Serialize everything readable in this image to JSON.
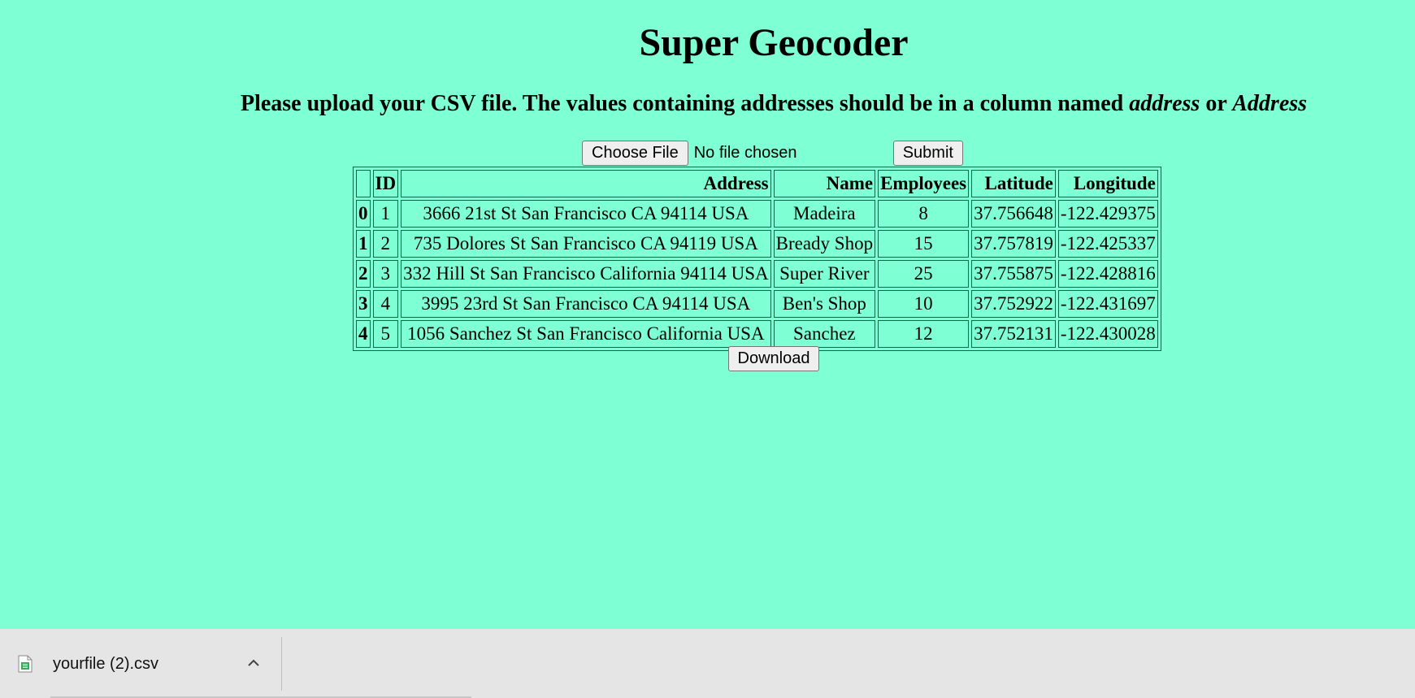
{
  "page": {
    "title": "Super Geocoder",
    "instructions_prefix": "Please upload your CSV file. The values containing addresses should be in a column named ",
    "instructions_em1": "address",
    "instructions_mid": " or ",
    "instructions_em2": "Address",
    "background_color": "#7fffd4"
  },
  "upload": {
    "choose_file_label": "Choose File",
    "file_status": "No file chosen",
    "submit_label": "Submit"
  },
  "table": {
    "headers": [
      "",
      "ID",
      "Address",
      "Name",
      "Employees",
      "Latitude",
      "Longitude"
    ],
    "rows": [
      {
        "index": "0",
        "id": "1",
        "address": "3666 21st St San Francisco CA 94114 USA",
        "name": "Madeira",
        "employees": "8",
        "latitude": "37.756648",
        "longitude": "-122.429375"
      },
      {
        "index": "1",
        "id": "2",
        "address": "735 Dolores St San Francisco CA 94119 USA",
        "name": "Bready Shop",
        "employees": "15",
        "latitude": "37.757819",
        "longitude": "-122.425337"
      },
      {
        "index": "2",
        "id": "3",
        "address": "332 Hill St San Francisco California 94114 USA",
        "name": "Super River",
        "employees": "25",
        "latitude": "37.755875",
        "longitude": "-122.428816"
      },
      {
        "index": "3",
        "id": "4",
        "address": "3995 23rd St San Francisco CA 94114 USA",
        "name": "Ben's Shop",
        "employees": "10",
        "latitude": "37.752922",
        "longitude": "-122.431697"
      },
      {
        "index": "4",
        "id": "5",
        "address": "1056 Sanchez St San Francisco California USA",
        "name": "Sanchez",
        "employees": "12",
        "latitude": "37.752131",
        "longitude": "-122.430028"
      }
    ]
  },
  "download": {
    "label": "Download"
  },
  "download_bar": {
    "file_name": "yourfile (2).csv",
    "file_icon": "csv-file-icon",
    "menu_icon": "chevron-up-icon"
  }
}
